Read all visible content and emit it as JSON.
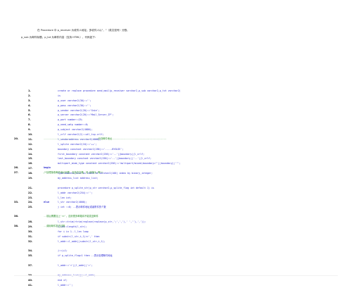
{
  "intro": {
    "line1": "在 Procedure 中 p_receiver 为收件人地址，多收件人以\"，\"（英文逗号）分割。",
    "line2": "p_sub 为邮件标题，p_txt 为邮件内容（支持 HTML），代码如下："
  },
  "code_lines": [
    {
      "n": "1.",
      "text": "create or replace procedure send_mail(p_receiver varchar2,p_sub varchar2,p_txt varchar2)",
      "kind": "code"
    },
    {
      "n": "2.",
      "text": "is",
      "kind": "code"
    },
    {
      "n": "3.",
      "text": "p_user varchar2(30):='';",
      "kind": "code"
    },
    {
      "n": "4.",
      "text": "p_pass varchar2(30):='';",
      "kind": "code"
    },
    {
      "n": "5.",
      "text": "p_sendor varchar2(20):='Gnie';",
      "kind": "code"
    },
    {
      "n": "6.",
      "text": "p_server varchar2(20):='Mail_Server_IP';",
      "kind": "code"
    },
    {
      "n": "7.",
      "text": "p_port number:=25;",
      "kind": "code"
    },
    {
      "n": "8.",
      "text": "p_need_smtp number:=0;",
      "kind": "code"
    },
    {
      "n": "9.",
      "text": "p_subject varchar2(4000);",
      "kind": "code"
    },
    {
      "n": "10.",
      "text": "l_crlf varchar2(2):=utl_tcp.crlf;",
      "kind": "code"
    },
    {
      "n": "11.",
      "text": "l_sendoraddress varchar2(4000);",
      "kind": "code"
    },
    {
      "n": "12.",
      "text": "l_splite varchar2(10):='++';",
      "kind": "code"
    },
    {
      "n": "13.",
      "text": "boundary constant varchar2(256):='-----BYSUIE';",
      "kind": "code"
    },
    {
      "n": "14.",
      "text": "first_boundary constant varchar2(256):='--'||boundary||l_crlf;",
      "kind": "code"
    },
    {
      "n": "15.",
      "text": "last_boundary constant varchar2(256):='--'||boundary||'--'||l_crlf;",
      "kind": "code"
    },
    {
      "n": "16.",
      "text": "multipart_mime_type constant varchar2(256):='multipart/mixed;boundary=\"'||boundary||'\"';",
      "kind": "code"
    },
    {
      "n": "17.",
      "text": "",
      "kind": "code"
    },
    {
      "n": "18.",
      "text": "type address_list is table of varchar2(100) index by binary_integer;",
      "kind": "code"
    },
    {
      "n": "19.",
      "text": "my_address_list address_list;",
      "kind": "code"
    },
    {
      "n": "20.",
      "text": "---------------------------------------分割邮件地址---------------------------------------",
      "kind": "comment"
    },
    {
      "n": "21.",
      "text": "procedure p_splite_str(p_str varchar2,p_splite_flag int default 1) is",
      "kind": "code"
    },
    {
      "n": "22.",
      "text": "l_addr varchar2(254):='';",
      "kind": "code"
    },
    {
      "n": "23.",
      "text": "l_len int;",
      "kind": "code"
    },
    {
      "n": "24.",
      "text": "l_str varchar2(4000);",
      "kind": "code"
    },
    {
      "n": "25.",
      "text": "j int :=0; --表示邮件地址或者附件的个数",
      "kind": "code"
    },
    {
      "n": "26.",
      "text": "begin",
      "kind": "keyword"
    },
    {
      "n": "27.",
      "text": "/*处理接收邮件地址列表，包括去空格、将;转换为,等*/",
      "kind": "comment"
    },
    {
      "n": "28.",
      "text": "l_str:=trim(rtrim(replace(replace(p_str,';',','),' ',''),','));",
      "kind": "code"
    },
    {
      "n": "29.",
      "text": "l_len:=length(l_str);",
      "kind": "code"
    },
    {
      "n": "30.",
      "text": "for i in 1..l_len loop",
      "kind": "code"
    },
    {
      "n": "31.",
      "text": "if substr(l_str,i,1)<>',' then",
      "kind": "code"
    },
    {
      "n": "32.",
      "text": "l_addr:=l_addr||substr(l_str,i,1);",
      "kind": "code"
    },
    {
      "n": "33.",
      "text": "else",
      "kind": "keyword"
    },
    {
      "n": "34.",
      "text": "j:=j+1;",
      "kind": "code"
    },
    {
      "n": "35.",
      "text": "if p_splite_flag=1 then --表示处理邮件地址",
      "kind": "code"
    },
    {
      "n": "36.",
      "text": "--前后需要加上'<>'，否则很多邮箱将不能发送邮件",
      "kind": "comment"
    },
    {
      "n": "37.",
      "text": "l_addr:='<'||l_addr||'>';",
      "kind": "code"
    },
    {
      "n": "38.",
      "text": "--调用邮件发送过程",
      "kind": "comment"
    },
    {
      "n": "39.",
      "text": "my_address_list(j):=l_addr;",
      "kind": "code"
    },
    {
      "n": "40.",
      "text": "end if;",
      "kind": "code"
    },
    {
      "n": "41.",
      "text": "l_addr:='';",
      "kind": "code"
    }
  ]
}
